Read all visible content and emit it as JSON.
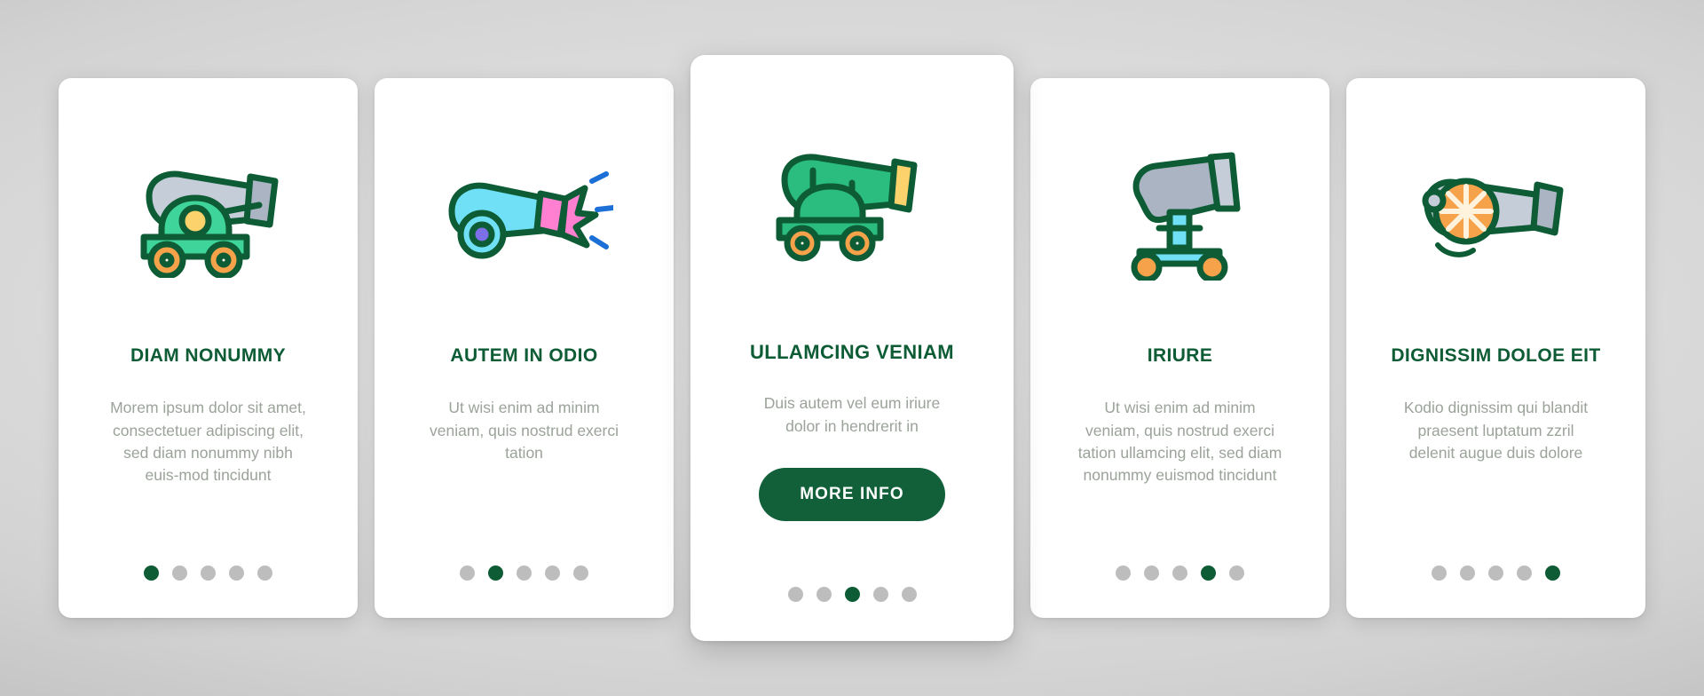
{
  "theme": {
    "accent_green": "#0d5c35",
    "button_green": "#11603a",
    "body_text_gray": "#9ba39a",
    "dot_inactive": "#bdbdbd",
    "card_bg": "#ffffff",
    "page_bg": "#d2d2d2"
  },
  "cards": [
    {
      "icon": "cannon-gray-barrel-icon",
      "title": "DIAM NONUMMY",
      "description": "Morem ipsum dolor sit amet, consectetuer adipiscing elit, sed diam nonummy nibh euis-mod tincidunt",
      "dots_total": 5,
      "dot_active_index": 0,
      "featured": false
    },
    {
      "icon": "cannon-firing-pink-blast-icon",
      "title": "AUTEM IN ODIO",
      "description": "Ut wisi enim ad minim veniam, quis nostrud exerci tation",
      "dots_total": 5,
      "dot_active_index": 1,
      "featured": false
    },
    {
      "icon": "cannon-green-icon",
      "title": "ULLAMCING VENIAM",
      "description": "Duis autem vel eum iriure dolor in hendrerit in",
      "button_label": "MORE INFO",
      "dots_total": 5,
      "dot_active_index": 2,
      "featured": true
    },
    {
      "icon": "cannon-mortar-upright-icon",
      "title": "IRIURE",
      "description": "Ut wisi enim ad minim veniam, quis nostrud exerci tation ullamcing elit, sed diam nonummy euismod tincidunt",
      "dots_total": 5,
      "dot_active_index": 3,
      "featured": false
    },
    {
      "icon": "cannon-orange-wheel-icon",
      "title": "DIGNISSIM DOLOE EIT",
      "description": "Kodio dignissim qui blandit praesent luptatum zzril delenit augue duis dolore",
      "dots_total": 5,
      "dot_active_index": 4,
      "featured": false
    }
  ]
}
